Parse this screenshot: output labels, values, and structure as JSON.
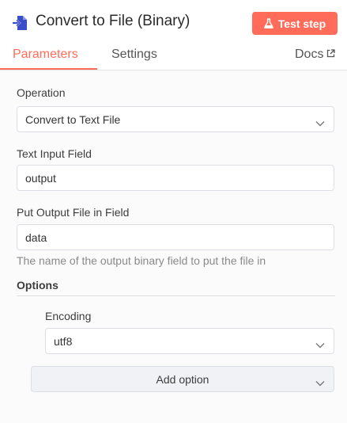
{
  "header": {
    "title": "Convert to File (Binary)",
    "node_icon": "file-export-icon",
    "test_step_label": "Test step",
    "test_step_icon": "flask-icon",
    "accent_color": "#ff6d5a"
  },
  "tabs": [
    {
      "label": "Parameters",
      "active": true
    },
    {
      "label": "Settings",
      "active": false
    },
    {
      "label": "Docs",
      "icon": "external-link-icon",
      "active": false
    }
  ],
  "form": {
    "operation": {
      "label": "Operation",
      "value": "Convert to Text File"
    },
    "text_input_field": {
      "label": "Text Input Field",
      "value": "output"
    },
    "output_field": {
      "label": "Put Output File in Field",
      "value": "data",
      "hint": "The name of the output binary field to put the file in"
    },
    "options": {
      "title": "Options",
      "encoding": {
        "label": "Encoding",
        "value": "utf8"
      },
      "add_option_label": "Add option"
    }
  }
}
